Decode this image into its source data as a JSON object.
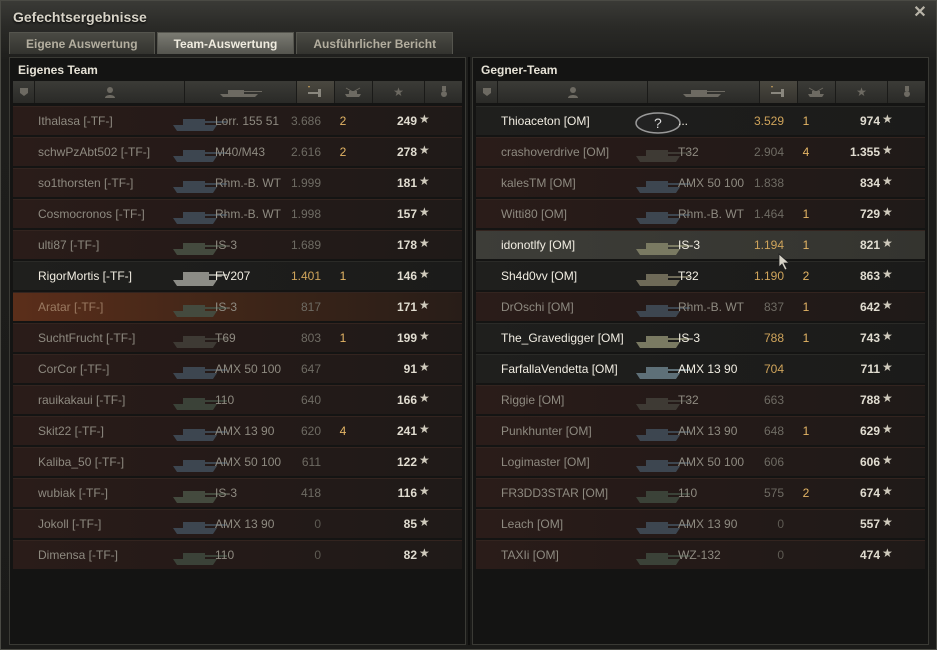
{
  "window": {
    "title": "Gefechtsergebnisse",
    "close_icon": "close-icon"
  },
  "tabs": [
    {
      "label": "Eigene Auswertung",
      "active": false
    },
    {
      "label": "Team-Auswertung",
      "active": true
    },
    {
      "label": "Ausführlicher Bericht",
      "active": false
    }
  ],
  "left_team": {
    "title": "Eigenes Team",
    "columns": [
      "squad-icon",
      "player-icon",
      "tank-icon",
      "damage-icon",
      "kills-icon",
      "xp-star-icon",
      "medal-icon"
    ],
    "rows": [
      {
        "player": "Ithalasa [-TF-]",
        "tank": "Lorr. 155 51",
        "damage": "3.686",
        "kills": "2",
        "xp": "249"
      },
      {
        "player": "schwPzAbt502 [-TF-]",
        "tank": "M40/M43",
        "damage": "2.616",
        "kills": "2",
        "xp": "278"
      },
      {
        "player": "so1thorsten [-TF-]",
        "tank": "Rhm.-B. WT",
        "damage": "1.999",
        "kills": "",
        "xp": "181"
      },
      {
        "player": "Cosmocronos [-TF-]",
        "tank": "Rhm.-B. WT",
        "damage": "1.998",
        "kills": "",
        "xp": "157"
      },
      {
        "player": "ulti87 [-TF-]",
        "tank": "IS-3",
        "damage": "1.689",
        "kills": "",
        "xp": "178"
      },
      {
        "player": "RigorMortis [-TF-]",
        "tank": "FV207",
        "damage": "1.401",
        "kills": "1",
        "xp": "146"
      },
      {
        "player": "Aratar [-TF-]",
        "tank": "IS-3",
        "damage": "817",
        "kills": "",
        "xp": "171"
      },
      {
        "player": "SuchtFrucht [-TF-]",
        "tank": "T69",
        "damage": "803",
        "kills": "1",
        "xp": "199"
      },
      {
        "player": "CorCor [-TF-]",
        "tank": "AMX 50 100",
        "damage": "647",
        "kills": "",
        "xp": "91"
      },
      {
        "player": "rauikakaui [-TF-]",
        "tank": "110",
        "damage": "640",
        "kills": "",
        "xp": "166"
      },
      {
        "player": "Skit22 [-TF-]",
        "tank": "AMX 13 90",
        "damage": "620",
        "kills": "4",
        "xp": "241"
      },
      {
        "player": "Kaliba_50 [-TF-]",
        "tank": "AMX 50 100",
        "damage": "611",
        "kills": "",
        "xp": "122"
      },
      {
        "player": "wubiak [-TF-]",
        "tank": "IS-3",
        "damage": "418",
        "kills": "",
        "xp": "116"
      },
      {
        "player": "Jokoll [-TF-]",
        "tank": "AMX 13 90",
        "damage": "0",
        "kills": "",
        "xp": "85"
      },
      {
        "player": "Dimensa [-TF-]",
        "tank": "110",
        "damage": "0",
        "kills": "",
        "xp": "82"
      }
    ]
  },
  "right_team": {
    "title": "Gegner-Team",
    "columns": [
      "squad-icon",
      "player-icon",
      "tank-icon",
      "damage-icon",
      "kills-icon",
      "xp-star-icon",
      "medal-icon"
    ],
    "rows": [
      {
        "player": "Thioaceton [OM]",
        "tank": "...",
        "damage": "3.529",
        "kills": "1",
        "xp": "974"
      },
      {
        "player": "crashoverdrive [OM]",
        "tank": "T32",
        "damage": "2.904",
        "kills": "4",
        "xp": "1.355"
      },
      {
        "player": "kalesTM [OM]",
        "tank": "AMX 50 100",
        "damage": "1.838",
        "kills": "",
        "xp": "834"
      },
      {
        "player": "Witti80 [OM]",
        "tank": "Rhm.-B. WT",
        "damage": "1.464",
        "kills": "1",
        "xp": "729"
      },
      {
        "player": "idonotlfy [OM]",
        "tank": "IS-3",
        "damage": "1.194",
        "kills": "1",
        "xp": "821"
      },
      {
        "player": "Sh4d0vv [OM]",
        "tank": "T32",
        "damage": "1.190",
        "kills": "2",
        "xp": "863"
      },
      {
        "player": "DrOschi [OM]",
        "tank": "Rhm.-B. WT",
        "damage": "837",
        "kills": "1",
        "xp": "642"
      },
      {
        "player": "The_Gravedigger [OM]",
        "tank": "IS-3",
        "damage": "788",
        "kills": "1",
        "xp": "743"
      },
      {
        "player": "FarfallaVendetta [OM]",
        "tank": "AMX 13 90",
        "damage": "704",
        "kills": "",
        "xp": "711"
      },
      {
        "player": "Riggie [OM]",
        "tank": "T32",
        "damage": "663",
        "kills": "",
        "xp": "788"
      },
      {
        "player": "Punkhunter [OM]",
        "tank": "AMX 13 90",
        "damage": "648",
        "kills": "1",
        "xp": "629"
      },
      {
        "player": "Logimaster [OM]",
        "tank": "AMX 50 100",
        "damage": "606",
        "kills": "",
        "xp": "606"
      },
      {
        "player": "FR3DD3STAR [OM]",
        "tank": "110",
        "damage": "575",
        "kills": "2",
        "xp": "674"
      },
      {
        "player": "Leach [OM]",
        "tank": "AMX 13 90",
        "damage": "0",
        "kills": "",
        "xp": "557"
      },
      {
        "player": "TAXIi [OM]",
        "tank": "WZ-132",
        "damage": "0",
        "kills": "",
        "xp": "474"
      }
    ]
  },
  "colors": {
    "highlight_gold": "#cfa45b",
    "kills_color": "#e4b565",
    "self_row": "#5b2e1a"
  }
}
